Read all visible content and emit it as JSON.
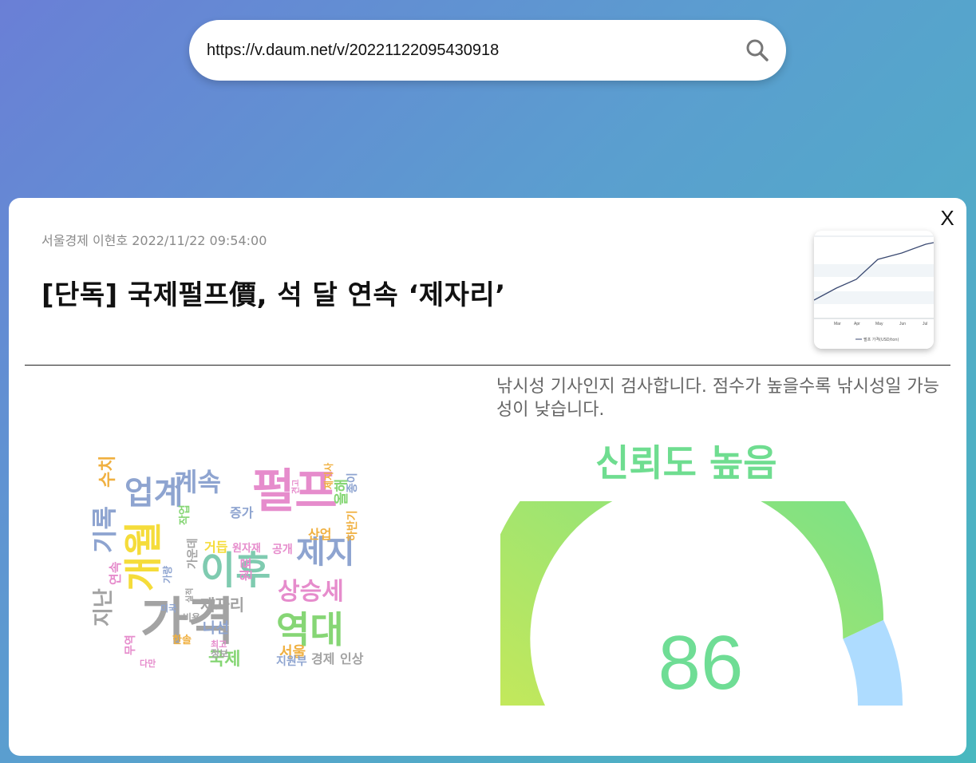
{
  "search": {
    "value": "https://v.daum.net/v/20221122095430918",
    "icon": "search-icon"
  },
  "article": {
    "meta": "서울경제 이현호 2022/11/22 09:54:00",
    "title": "[단독] 국제펄프價, 석 달 연속 ‘제자리’",
    "close_label": "X",
    "thumbnail": {
      "x_labels": [
        "Mar",
        "Apr",
        "May",
        "Jun",
        "Jul"
      ],
      "legend": "펄프 가격(USD/ton)"
    }
  },
  "analysis": {
    "description": "낚시성 기사인지 검사합니다. 점수가 높을수록 낚시성일 가능성이 낮습니다.",
    "verdict": "신뢰도 높음",
    "score": "86",
    "score_value": 86,
    "colors": {
      "gauge_start": "#c5e85a",
      "gauge_end": "#6ee08e",
      "gauge_rest": "#aedcff",
      "accent": "#6fdd90"
    }
  },
  "wordcloud": {
    "words": [
      "펄프",
      "가격",
      "이후",
      "개월",
      "제지",
      "역대",
      "상승세",
      "업계",
      "계속",
      "기록",
      "수치",
      "연속",
      "제자리",
      "나선",
      "국제",
      "서울",
      "경제",
      "인상",
      "지원부",
      "산업",
      "원자재",
      "거듭",
      "공개",
      "올해",
      "지난",
      "최고",
      "정보",
      "미국",
      "한솔",
      "가운데",
      "작업",
      "비용",
      "제지사",
      "가량",
      "증가",
      "실적",
      "다만",
      "무역",
      "종이",
      "하반기",
      "견고",
      "원료"
    ]
  }
}
